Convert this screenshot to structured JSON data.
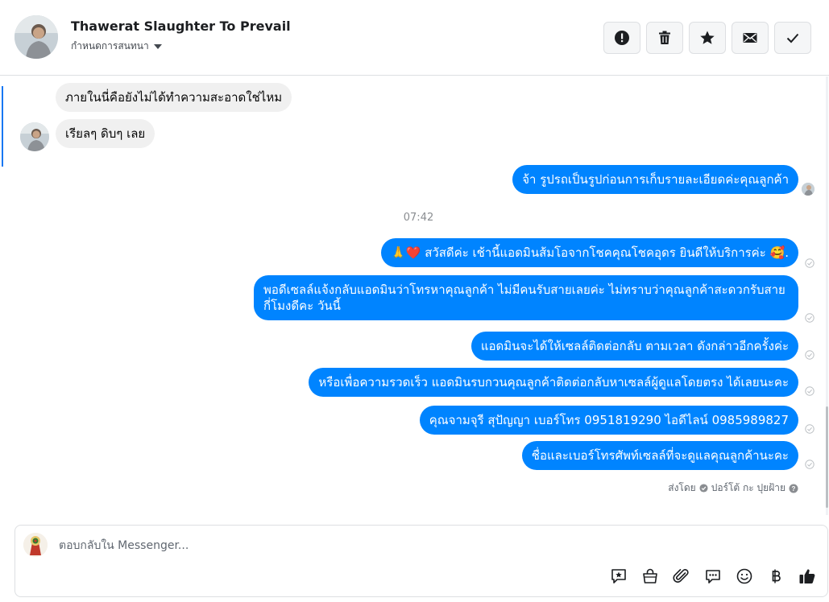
{
  "header": {
    "title": "Thawerat Slaughter To Prevail",
    "subtitle": "กำหนดการสนทนา",
    "toolbar": [
      {
        "icon": "alert-icon"
      },
      {
        "icon": "trash-icon"
      },
      {
        "icon": "star-icon"
      },
      {
        "icon": "mail-icon"
      },
      {
        "icon": "checkmark-icon"
      }
    ]
  },
  "thread": {
    "incoming": [
      {
        "text": "ภายในนี่คือยังไม่ได้ทำความสะอาดใช่ไหม"
      },
      {
        "text": "เรียลๆ ดิบๆ เลย"
      }
    ],
    "outgoing_before": {
      "text": "จ้า  รูปรถเป็นรูปก่อนการเก็บรายละเอียดค่ะคุณลูกค้า"
    },
    "timestamp": "07:42",
    "outgoing": [
      {
        "text": "🙏❤️ สวัสดีค่ะ เช้านี้แอดมินส้มโอจากโชคคุณโชคอุดร ยินดีให้บริการค่ะ  🥰."
      },
      {
        "text": "พอดีเซลล์แจ้งกลับแอดมินว่าโทรหาคุณลูกค้า ไม่มีคนรับสายเลยค่ะ ไม่ทราบว่าคุณลูกค้าสะดวกรับสายกี่โมงดีคะ วันนี้"
      },
      {
        "text": "แอดมินจะได้ให้เซลล์ติดต่อกลับ ตามเวลา ดังกล่าวอีกครั้งค่ะ"
      },
      {
        "text": "หรือเพื่อความรวดเร็ว แอดมินรบกวนคุณลูกค้าติดต่อกลับหาเซลล์ผู้ดูแลโดยตรง ได้เลยนะคะ"
      },
      {
        "text": "คุณจามจุรี สุปัญญา เบอร์โทร 0951819290  ไอดีไลน์ 0985989827"
      },
      {
        "text": "ชื่อและเบอร์โทรศัพท์เซลล์ที่จะดูแลคุณลูกค้านะคะ"
      }
    ],
    "sent_by_label": "ส่งโดย",
    "sent_by_name": "ปอร์โต้ กะ ปุยฝ้าย"
  },
  "composer": {
    "placeholder": "ตอบกลับใน Messenger...",
    "icons": [
      "saved-reply-icon",
      "shop-icon",
      "attach-icon",
      "chat-icon",
      "emoji-icon",
      "baht-icon",
      "like-icon"
    ]
  },
  "colors": {
    "outgoing_bubble": "#0084ff",
    "incoming_bubble": "#f0f0f0",
    "accent": "#1877f2"
  }
}
